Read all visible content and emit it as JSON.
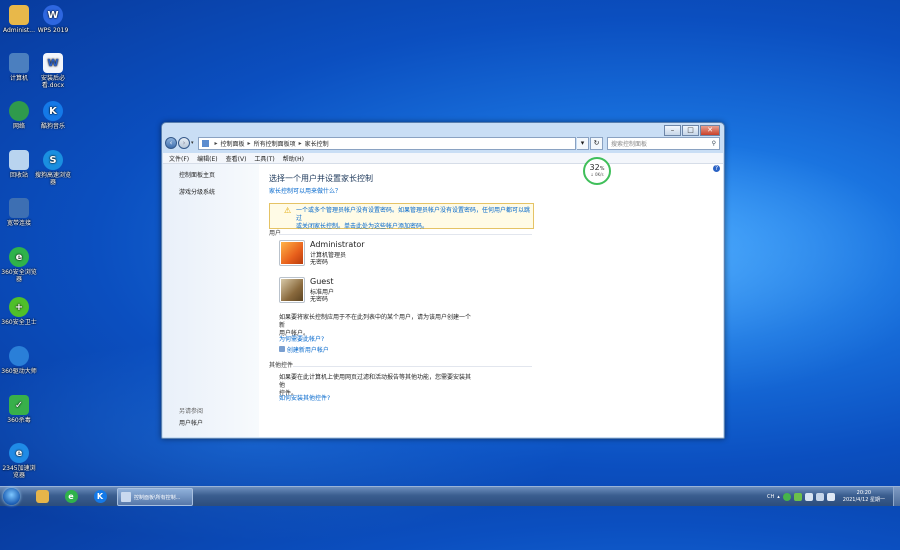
{
  "desktop": {
    "icons": [
      {
        "label": "Administ..."
      },
      {
        "label": "WPS 2019"
      },
      {
        "label": "计算机"
      },
      {
        "label": "安装后必看.docx"
      },
      {
        "label": "网络"
      },
      {
        "label": "酷狗音乐"
      },
      {
        "label": "回收站"
      },
      {
        "label": "搜狗高速浏览器"
      },
      {
        "label": "宽带连接"
      },
      {
        "label": "360安全浏览器"
      },
      {
        "label": "360安全卫士"
      },
      {
        "label": "360驱动大师"
      },
      {
        "label": "360杀毒"
      },
      {
        "label": "2345加速浏览器"
      }
    ]
  },
  "window": {
    "breadcrumb": [
      "控制面板",
      "所有控制面板项",
      "家长控制"
    ],
    "search_placeholder": "搜索控制面板",
    "menu": [
      "文件(F)",
      "编辑(E)",
      "查看(V)",
      "工具(T)",
      "帮助(H)"
    ],
    "sidebar": {
      "home": "控制面板主页",
      "game_ratings": "游戏分级系统",
      "see_also_heading": "另请参阅",
      "user_accounts": "用户帐户"
    },
    "content": {
      "title": "选择一个用户并设置家长控制",
      "how_link": "家长控制可以用来做什么？",
      "warning_line1": "一个或多个管理员帐户没有设置密码。如果管理员帐户没有设置密码，任何用户都可以跳过",
      "warning_line2": "或关闭家长控制。单击此处为这些帐户添加密码。",
      "users_heading": "用户",
      "users": [
        {
          "name": "Administrator",
          "role": "计算机管理员",
          "password": "无密码"
        },
        {
          "name": "Guest",
          "role": "标准用户",
          "password": "无密码"
        }
      ],
      "new_user_text_1": "如果要将家长控制应用于不在此列表中的某个用户，请为该用户创建一个新",
      "new_user_text_2": "用户帐户。",
      "why_link": "为何需要此帐户?",
      "create_link": "创建新用户帐户",
      "other_controls_heading": "其他控件",
      "other_text_1": "如果要在此计算机上使用网页过滤和活动报告等其他功能，您需要安装其他",
      "other_text_2": "控件。",
      "install_link": "如何安装其他控件?"
    }
  },
  "network_gauge": {
    "percent": "32",
    "unit": "%",
    "speed": "0K/s"
  },
  "taskbar": {
    "active_window_label": "控制面板\\所有控制...",
    "tray_lang": "CH",
    "clock_time": "20:20",
    "clock_date": "2021/4/12 星期一"
  },
  "colors": {
    "link": "#0066cc",
    "title": "#1e395b",
    "gauge_ring": "#3fbf5a"
  }
}
